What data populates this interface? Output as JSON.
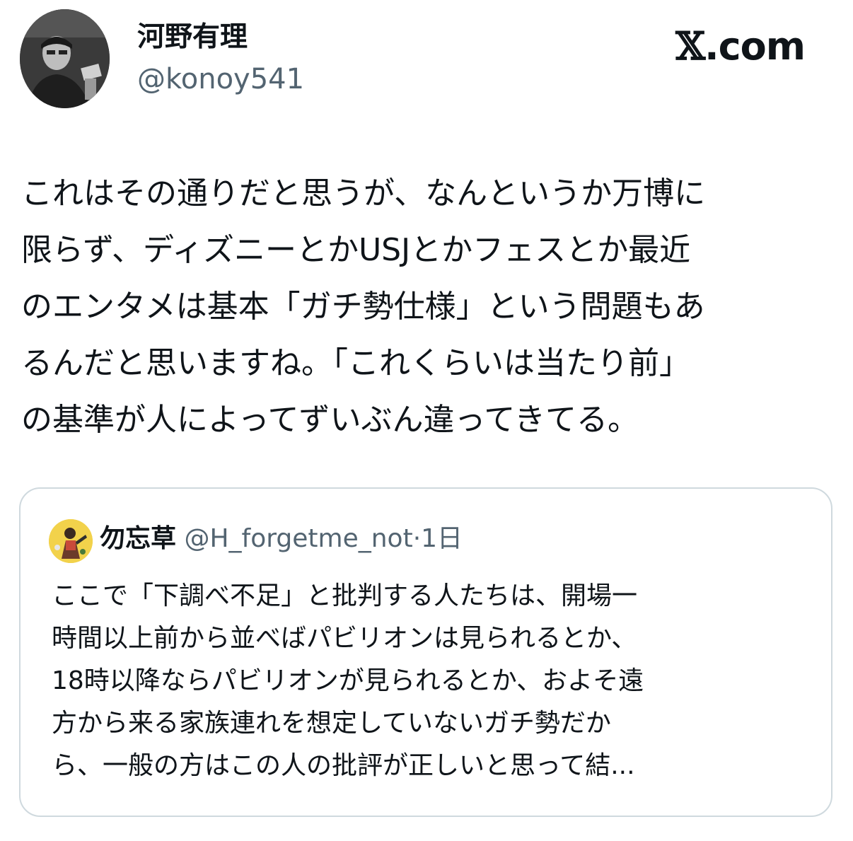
{
  "author": {
    "display_name": "河野有理",
    "handle": "@konoy541"
  },
  "brand": {
    "logo_glyph": "𝕏",
    "logo_suffix": ".com"
  },
  "tweet": {
    "lines": [
      "これはその通りだと思うが、なんというか万博に",
      "限らず、ディズニーとかUSJとかフェスとか最近",
      "のエンタメは基本「ガチ勢仕様」という問題もあ",
      "るんだと思いますね。「これくらいは当たり前」",
      "の基準が人によってずいぶん違ってきてる。"
    ]
  },
  "quoted": {
    "display_name": "勿忘草",
    "handle": "@H_forgetme_not",
    "separator": "·",
    "time": "1日",
    "lines": [
      "ここで「下調べ不足」と批判する人たちは、開場一",
      "時間以上前から並べばパビリオンは見られるとか、",
      "18時以降ならパビリオンが見られるとか、およそ遠",
      "方から来る家族連れを想定していないガチ勢だか",
      "ら、一般の方はこの人の批評が正しいと思って結..."
    ]
  },
  "colors": {
    "text": "#0f1419",
    "secondary": "#536471",
    "border": "#cfd9de"
  }
}
